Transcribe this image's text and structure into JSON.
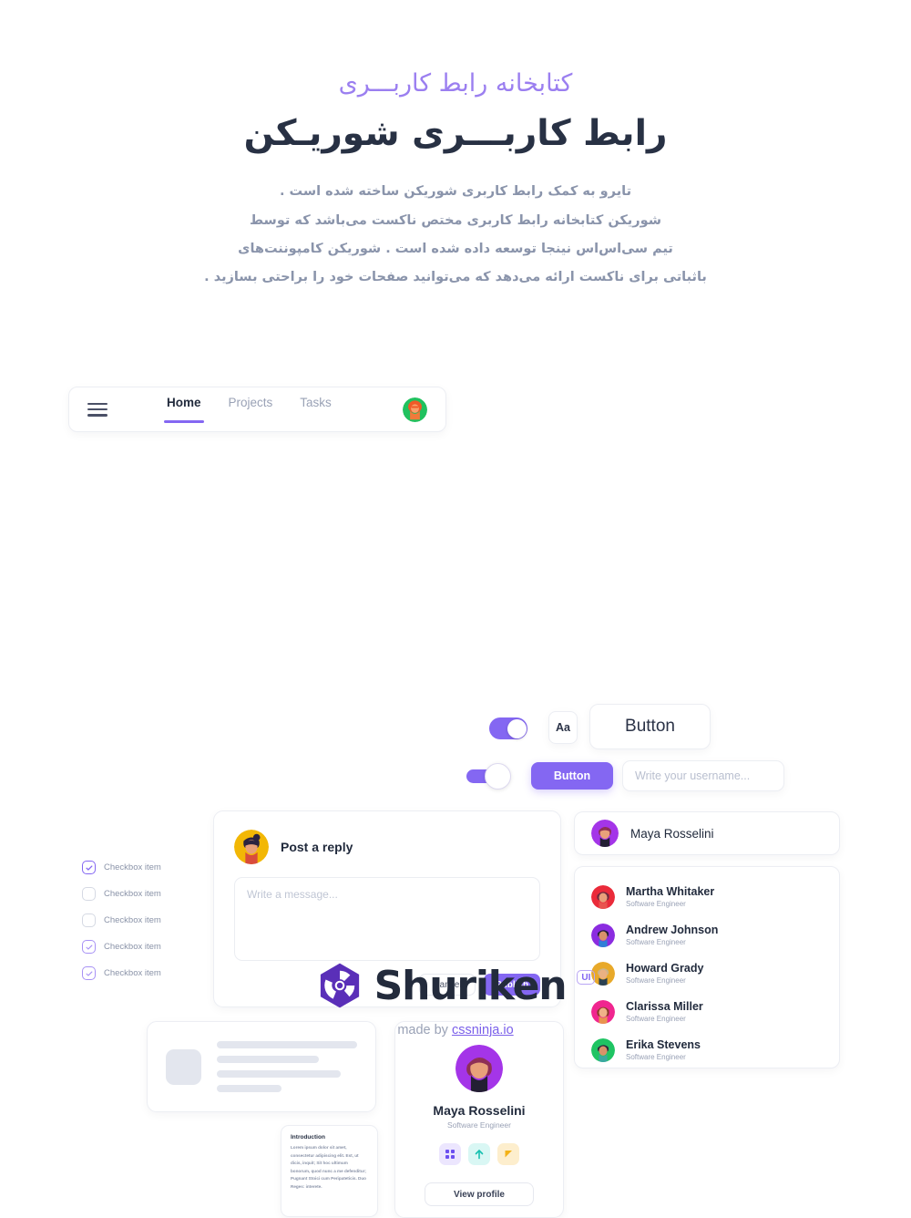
{
  "hero": {
    "eyebrow": "کتابخانه رابط کاربـــری",
    "title": "رابط کاربـــری شوریـکن",
    "paragraph_lines": [
      "تایرو به کمک رابط کاربری شوریکن ساخته شده است .",
      "شوریکن کتابخانه رابط کاربری مختص ناکست می‌باشد که توسط",
      "تیم سی‌اس‌اس نینجا توسعه داده شده است .  شوریکن کامپوننت‌های",
      "باثباتی برای ناکست ارائه می‌دهد که می‌توانید صفحات خود را براحتی بسازید ."
    ]
  },
  "colors": {
    "accent_purple": "#8467f2",
    "eyebrow_purple": "#9b7ff0",
    "heading_navy": "#283144",
    "logo_purple": "#5a2fb8",
    "muted_text": "#8a94ab",
    "skeleton_gray": "#e3e6ee"
  },
  "navbar": {
    "menu_icon": "hamburger-menu-icon",
    "links": [
      {
        "label": "Home",
        "active": true
      },
      {
        "label": "Projects",
        "active": false
      },
      {
        "label": "Tasks",
        "active": false
      }
    ],
    "avatar": {
      "name": "nav-user-avatar",
      "bg": "#20c15e",
      "hair": "#f05a28"
    }
  },
  "controls": {
    "toggle_top": {
      "state": "on",
      "track": "#8467f2"
    },
    "toggle_bottom": {
      "state": "on",
      "track": "#8467f2"
    },
    "font_chip_label": "Aa",
    "button_outline_label": "Button",
    "button_solid_label": "Button",
    "username_input": {
      "value": "",
      "placeholder": "Write your username..."
    }
  },
  "checklist": {
    "items": [
      {
        "label": "Checkbox item",
        "checked": true,
        "strong": true
      },
      {
        "label": "Checkbox item",
        "checked": false,
        "strong": false
      },
      {
        "label": "Checkbox item",
        "checked": false,
        "strong": false
      },
      {
        "label": "Checkbox item",
        "checked": true,
        "strong": false
      },
      {
        "label": "Checkbox item",
        "checked": true,
        "strong": false
      }
    ]
  },
  "reply_card": {
    "title": "Post a reply",
    "avatar": {
      "name": "reply-author-avatar",
      "bg": "#f2b705",
      "hair": "#2b2340"
    },
    "textarea": {
      "value": "",
      "placeholder": "Write a message..."
    },
    "cancel_label": "Cancel",
    "publish_label": "Publish"
  },
  "user_single": {
    "name": "Maya Rosselini",
    "avatar": {
      "bg": "#a435e8",
      "hair": "#8e2f56"
    }
  },
  "user_list": {
    "rows": [
      {
        "name": "Martha Whitaker",
        "role": "Software Engineer",
        "avatar": {
          "bg": "#ea2b3a",
          "hair": "#6d2a3e"
        }
      },
      {
        "name": "Andrew Johnson",
        "role": "Software Engineer",
        "avatar": {
          "bg": "#8b2ce0",
          "hair": "#23203a"
        }
      },
      {
        "name": "Howard Grady",
        "role": "Software Engineer",
        "avatar": {
          "bg": "#e8a92a",
          "hair": "#c9b48a"
        }
      },
      {
        "name": "Clarissa Miller",
        "role": "Software Engineer",
        "avatar": {
          "bg": "#f0268f",
          "hair": "#8c3b2a"
        }
      },
      {
        "name": "Erika Stevens",
        "role": "Software Engineer",
        "avatar": {
          "bg": "#1fc463",
          "hair": "#2e2a3c"
        }
      }
    ]
  },
  "skeleton": {
    "bar_widths": [
      "100%",
      "73%",
      "88%",
      "46%"
    ]
  },
  "intro_card": {
    "title": "Introduction",
    "body": "Lorem ipsum dolor sit amet, consectetur adipiscing elit. Est, ut dicis, inquit; Sit hoc ultimum bonorum, quod nunc a me defenditur; Pugnant Stoici cum Peripateticis. Duo Reges: interete."
  },
  "profile_card": {
    "name": "Maya Rosselini",
    "role": "Software Engineer",
    "avatar": {
      "bg": "#a435e8",
      "hair": "#8e2f56"
    },
    "chips": [
      {
        "icon": "grid-icon",
        "bg": "#ece6fe",
        "fg": "#6c4ff0"
      },
      {
        "icon": "arrow-up-icon",
        "bg": "#d9f7f4",
        "fg": "#16c0b0"
      },
      {
        "icon": "flag-icon",
        "bg": "#fdeecd",
        "fg": "#f3b218"
      }
    ],
    "button_label": "View profile"
  },
  "footer": {
    "logo_icon": "shuriken-hexagon-logo",
    "brand": "Shuriken",
    "badge": "UI",
    "made_by_prefix": "made by ",
    "made_by_link": "cssninja.io"
  }
}
